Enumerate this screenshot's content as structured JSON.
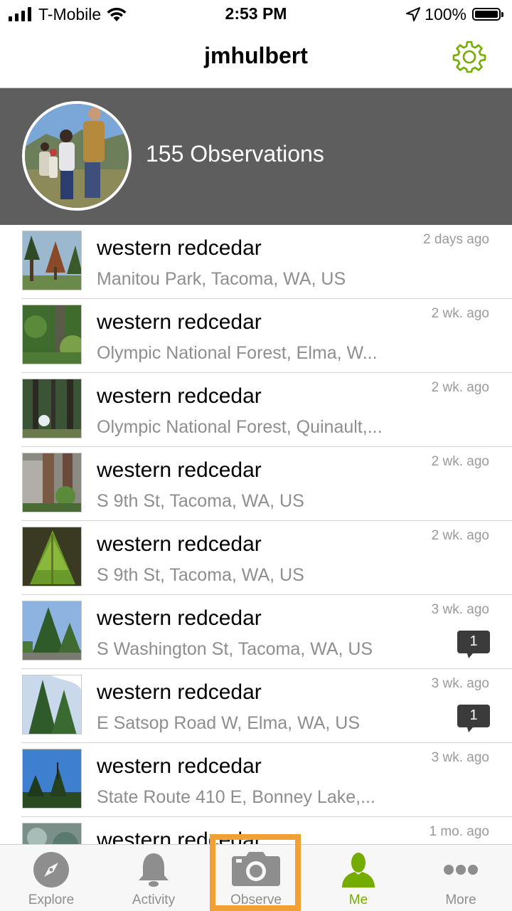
{
  "status_bar": {
    "carrier": "T-Mobile",
    "time": "2:53 PM",
    "battery": "100%",
    "icons": [
      "signal-icon",
      "wifi-icon",
      "location-arrow-icon",
      "battery-icon"
    ]
  },
  "nav": {
    "title": "jmhulbert",
    "settings_icon": "gear-icon"
  },
  "profile": {
    "observation_count": "155 Observations"
  },
  "observations": [
    {
      "name": "western redcedar",
      "place": "Manitou Park, Tacoma, WA, US",
      "time": "2 days ago",
      "comments": ""
    },
    {
      "name": "western redcedar",
      "place": "Olympic National Forest, Elma, W...",
      "time": "2 wk. ago",
      "comments": ""
    },
    {
      "name": "western redcedar",
      "place": "Olympic National Forest, Quinault,...",
      "time": "2 wk. ago",
      "comments": ""
    },
    {
      "name": "western redcedar",
      "place": "S 9th St, Tacoma, WA, US",
      "time": "2 wk. ago",
      "comments": ""
    },
    {
      "name": "western redcedar",
      "place": "S 9th St, Tacoma, WA, US",
      "time": "2 wk. ago",
      "comments": ""
    },
    {
      "name": "western redcedar",
      "place": "S Washington St, Tacoma, WA, US",
      "time": "3 wk. ago",
      "comments": "1"
    },
    {
      "name": "western redcedar",
      "place": "E Satsop Road W, Elma, WA, US",
      "time": "3 wk. ago",
      "comments": "1"
    },
    {
      "name": "western redcedar",
      "place": "State Route 410 E, Bonney Lake,...",
      "time": "3 wk. ago",
      "comments": ""
    },
    {
      "name": "western redcedar",
      "place": "",
      "time": "1 mo. ago",
      "comments": ""
    }
  ],
  "tabs": [
    {
      "label": "Explore",
      "icon": "compass-icon",
      "active": false
    },
    {
      "label": "Activity",
      "icon": "bell-icon",
      "active": false
    },
    {
      "label": "Observe",
      "icon": "camera-icon",
      "active": false
    },
    {
      "label": "Me",
      "icon": "person-icon",
      "active": true
    },
    {
      "label": "More",
      "icon": "ellipsis-icon",
      "active": false
    }
  ],
  "colors": {
    "accent_green": "#74ac00",
    "header_gray": "#5e5e5e",
    "highlight_orange": "#f0a034"
  }
}
